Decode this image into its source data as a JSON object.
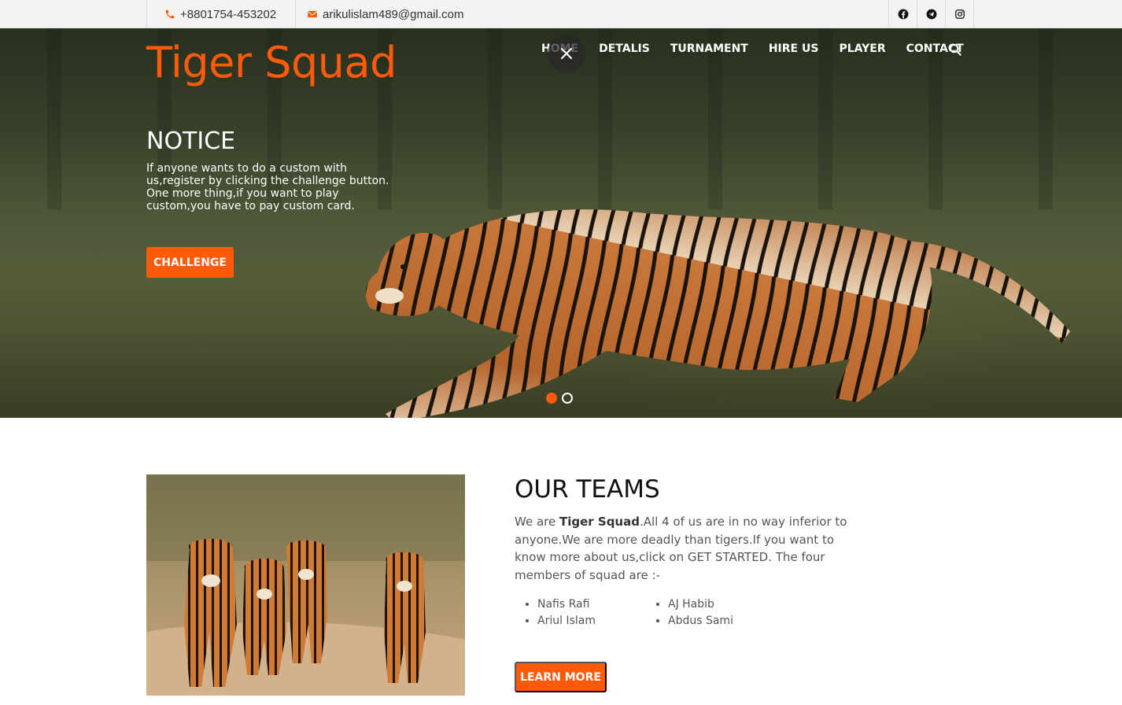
{
  "topbar": {
    "phone": "+8801754-453202",
    "email": "arikulislam489@gmail.com",
    "social": [
      "facebook-icon",
      "telegram-icon",
      "instagram-icon"
    ]
  },
  "brand": {
    "logo": "Tiger Squad",
    "accent_color": "#ff5a0a"
  },
  "nav": {
    "items": [
      "HOME",
      "DETALIS",
      "TURNAMENT",
      "HIRE US",
      "PLAYER",
      "CONTACT"
    ],
    "close_icon": "close-icon",
    "search_icon": "search-icon"
  },
  "hero": {
    "title": "NOTICE",
    "text": "If anyone wants to do a custom with us,register by clicking the challenge button. One more thing,if you want to play custom,you have to pay custom card.",
    "button": "CHALLENGE",
    "slides": 2,
    "active_slide": 1
  },
  "teams": {
    "title": "OUR TEAMS",
    "desc_pre": "We are ",
    "desc_bold": "Tiger Squad",
    "desc_post": ".All 4 of us are in no way inferior to anyone.We are more deadly than tigers.If you want to know more about us,click on GET STARTED. The four members of squad are :-",
    "members": [
      "Nafis Rafi",
      "AJ Habib",
      "Ariul Islam",
      "Abdus Sami"
    ],
    "button": "LEARN MORE"
  }
}
